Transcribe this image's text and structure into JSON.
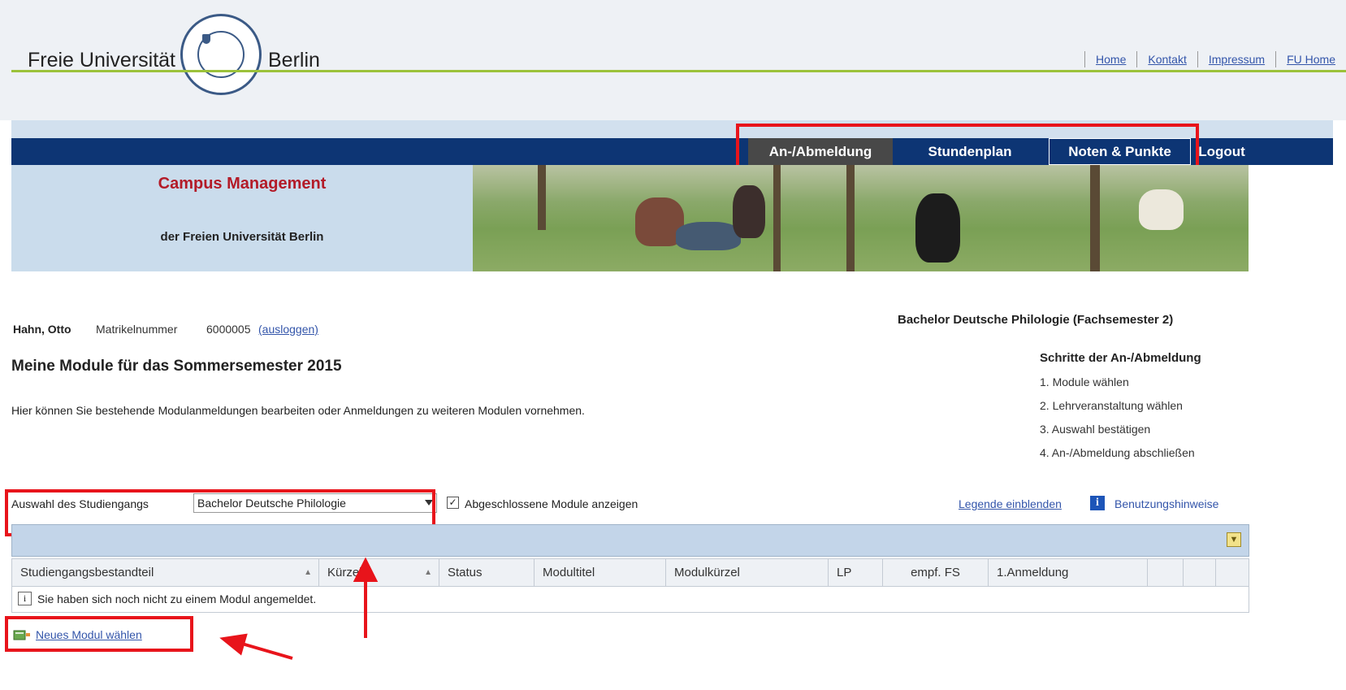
{
  "header": {
    "brand_left": "Freie Universität",
    "brand_right": "Berlin",
    "links": [
      "Home",
      "Kontakt",
      "Impressum",
      "FU Home"
    ]
  },
  "nav": {
    "items": [
      "An-/Abmeldung",
      "Stundenplan",
      "Noten & Punkte",
      "Logout"
    ]
  },
  "banner": {
    "title": "Campus Management",
    "subtitle": "der Freien Universität Berlin"
  },
  "student": {
    "name": "Hahn, Otto",
    "matrikel_label": "Matrikelnummer",
    "matrikel_number": "6000005",
    "logout_link": "(ausloggen)",
    "program": "Bachelor Deutsche Philologie (Fachsemester 2)"
  },
  "main": {
    "title": "Meine Module für das Sommersemester 2015",
    "description": "Hier können Sie bestehende Modulanmeldungen bearbeiten oder Anmeldungen zu weiteren Modulen vornehmen."
  },
  "steps": {
    "title": "Schritte der An-/Abmeldung",
    "items": [
      "1. Module wählen",
      "2. Lehrveranstaltung wählen",
      "3. Auswahl bestätigen",
      "4. An-/Abmeldung abschließen"
    ]
  },
  "filter": {
    "label": "Auswahl des Studiengangs",
    "selected": "Bachelor Deutsche Philologie",
    "checkbox_label": "Abgeschlossene Module anzeigen",
    "checked": true,
    "legend_link": "Legende einblenden",
    "help": "Benutzungshinweise"
  },
  "table": {
    "columns": [
      "Studiengangsbestandteil",
      "Kürzel",
      "Status",
      "Modultitel",
      "Modulkürzel",
      "LP",
      "empf. FS",
      "1.Anmeldung"
    ],
    "empty_message": "Sie haben sich noch nicht zu einem Modul angemeldet."
  },
  "actions": {
    "new_module": "Neues Modul wählen"
  },
  "colors": {
    "nav_bg": "#0d3574",
    "nav_active": "#484848",
    "highlight_red": "#e8141b",
    "accent_green": "#9cc23b",
    "brand_red": "#b31b28"
  }
}
